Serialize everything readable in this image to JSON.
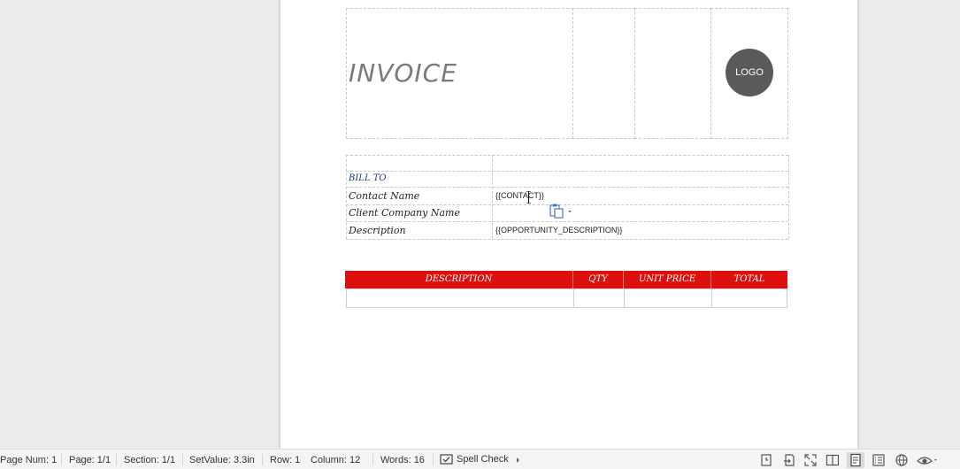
{
  "header": {
    "title": "INVOICE",
    "logo": "LOGO"
  },
  "bill_to": {
    "heading": "BILL TO",
    "rows": [
      {
        "label": "Contact Name",
        "value": "{{CONTACT}}"
      },
      {
        "label": "Client Company Name",
        "value": ""
      },
      {
        "label": "Description",
        "value": "{{OPPORTUNITY_DESCRIPTION}}"
      }
    ]
  },
  "items_table": {
    "columns": [
      "DESCRIPTION",
      "QTY",
      "UNIT PRICE",
      "TOTAL"
    ],
    "header_color": "#dd1010"
  },
  "status_bar": {
    "page_num": "Page Num: 1",
    "page": "Page: 1/1",
    "section": "Section: 1/1",
    "set_value": "SetValue: 3.3in",
    "row": "Row: 1",
    "column": "Column: 12",
    "words": "Words: 16",
    "spell_check": "Spell Check",
    "icons": [
      "doc-history-icon",
      "export-icon",
      "fullscreen-icon",
      "two-page-icon",
      "page-view-icon",
      "outline-view-icon",
      "web-view-icon",
      "eye-protection-icon"
    ]
  }
}
